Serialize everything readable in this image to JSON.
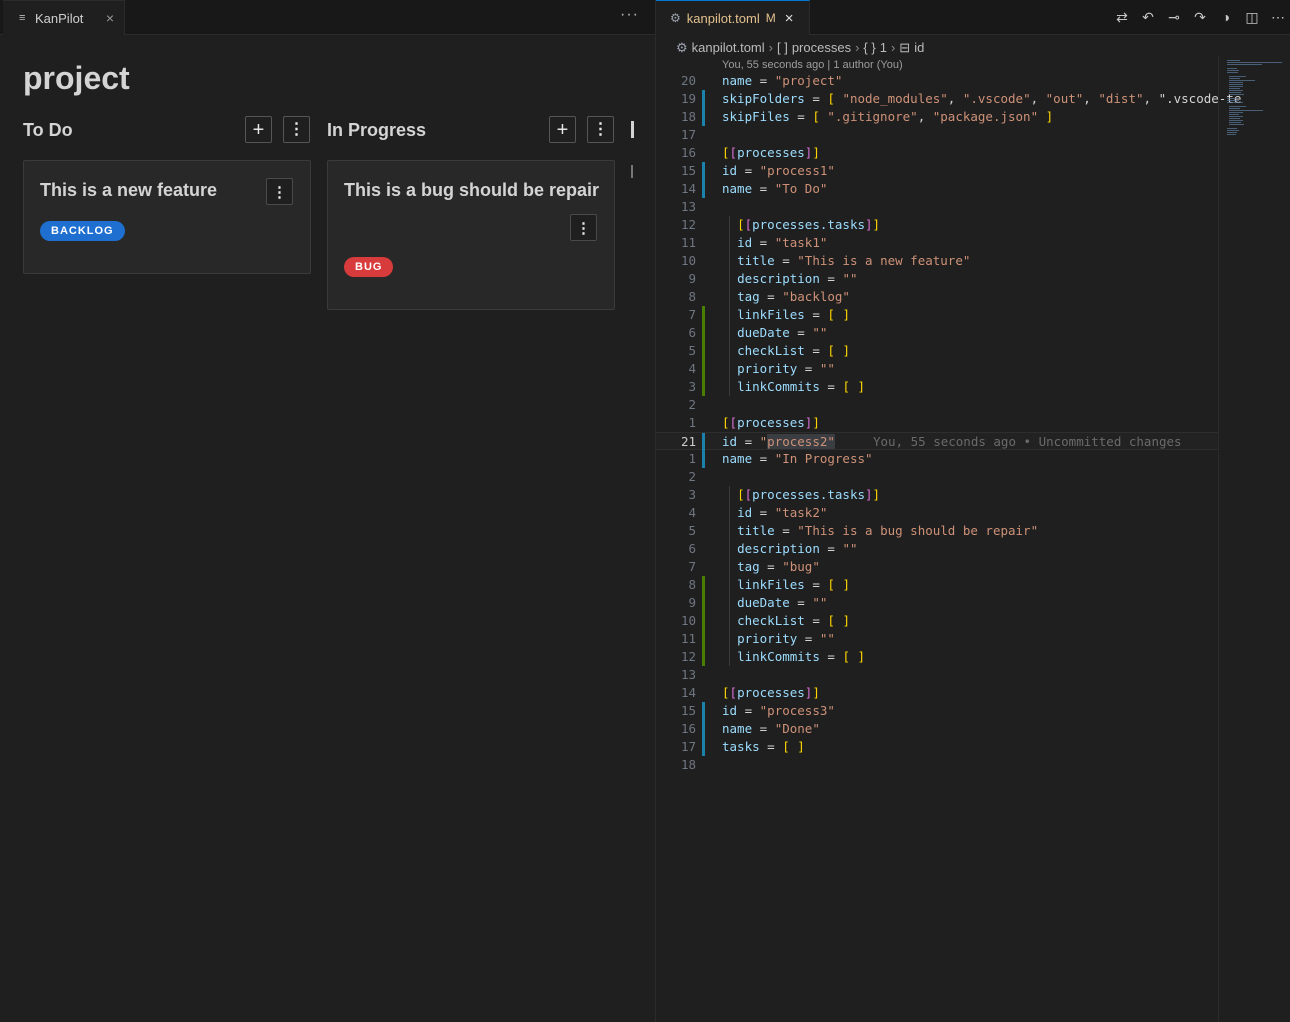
{
  "left_tab": {
    "label": "KanPilot",
    "close": "×"
  },
  "left_more": "···",
  "board": {
    "title": "project",
    "add_label": "+",
    "menu_label": "⋮",
    "columns": [
      {
        "name": "To Do",
        "card": {
          "title": "This is a new feature",
          "tag": "BACKLOG",
          "tag_color": "#1e6fd0"
        }
      },
      {
        "name": "In Progress",
        "card": {
          "title": "This is a bug should be repair",
          "tag": "BUG",
          "tag_color": "#d83b3b"
        }
      }
    ]
  },
  "right_tab": {
    "filename": "kanpilot.toml",
    "status": "M",
    "close": "×"
  },
  "breadcrumb": {
    "file": "kanpilot.toml",
    "array": "processes",
    "index": "1",
    "key": "id",
    "array_symbol": "[ ]",
    "obj_symbol": "{ }",
    "key_symbol": "⊟"
  },
  "codelens": "You, 55 seconds ago | 1 author (You)",
  "blame": "You, 55 seconds ago • Uncommitted changes",
  "editor_actions": [
    "compare-changes-icon",
    "go-back-icon",
    "git-commit-icon",
    "go-forward-icon",
    "open-changes-icon",
    "split-editor-icon",
    "more-actions-icon"
  ],
  "code_lines": [
    {
      "n": "20",
      "t": "name = \"project\""
    },
    {
      "n": "19",
      "t": "skipFolders = [ \"node_modules\", \".vscode\", \"out\", \"dist\", \".vscode-te"
    },
    {
      "n": "18",
      "t": "skipFiles = [ \".gitignore\", \"package.json\" ]"
    },
    {
      "n": "17",
      "t": ""
    },
    {
      "n": "16",
      "t": "[[processes]]"
    },
    {
      "n": "15",
      "t": "id = \"process1\""
    },
    {
      "n": "14",
      "t": "name = \"To Do\""
    },
    {
      "n": "13",
      "t": ""
    },
    {
      "n": "12",
      "t": "  [[processes.tasks]]"
    },
    {
      "n": "11",
      "t": "  id = \"task1\""
    },
    {
      "n": "10",
      "t": "  title = \"This is a new feature\""
    },
    {
      "n": "9",
      "t": "  description = \"\""
    },
    {
      "n": "8",
      "t": "  tag = \"backlog\""
    },
    {
      "n": "7",
      "t": "  linkFiles = [ ]"
    },
    {
      "n": "6",
      "t": "  dueDate = \"\""
    },
    {
      "n": "5",
      "t": "  checkList = [ ]"
    },
    {
      "n": "4",
      "t": "  priority = \"\""
    },
    {
      "n": "3",
      "t": "  linkCommits = [ ]"
    },
    {
      "n": "2",
      "t": ""
    },
    {
      "n": "1",
      "t": "[[processes]]"
    },
    {
      "n": "21",
      "t": "id = \"process2\""
    },
    {
      "n": "1",
      "t": "name = \"In Progress\""
    },
    {
      "n": "2",
      "t": ""
    },
    {
      "n": "3",
      "t": "  [[processes.tasks]]"
    },
    {
      "n": "4",
      "t": "  id = \"task2\""
    },
    {
      "n": "5",
      "t": "  title = \"This is a bug should be repair\""
    },
    {
      "n": "6",
      "t": "  description = \"\""
    },
    {
      "n": "7",
      "t": "  tag = \"bug\""
    },
    {
      "n": "8",
      "t": "  linkFiles = [ ]"
    },
    {
      "n": "9",
      "t": "  dueDate = \"\""
    },
    {
      "n": "10",
      "t": "  checkList = [ ]"
    },
    {
      "n": "11",
      "t": "  priority = \"\""
    },
    {
      "n": "12",
      "t": "  linkCommits = [ ]"
    },
    {
      "n": "13",
      "t": ""
    },
    {
      "n": "14",
      "t": "[[processes]]"
    },
    {
      "n": "15",
      "t": "id = \"process3\""
    },
    {
      "n": "16",
      "t": "name = \"Done\""
    },
    {
      "n": "17",
      "t": "tasks = [ ]"
    },
    {
      "n": "18",
      "t": ""
    }
  ],
  "colors": {
    "background": "#1f1f1f",
    "key": "#9cdcfe",
    "string": "#ce9178",
    "bracket_outer": "#ffd700",
    "bracket_inner": "#da70d6",
    "modified_gutter": "#1b81a8",
    "added_gutter": "#487e02",
    "tab_modified": "#e2c08d"
  }
}
